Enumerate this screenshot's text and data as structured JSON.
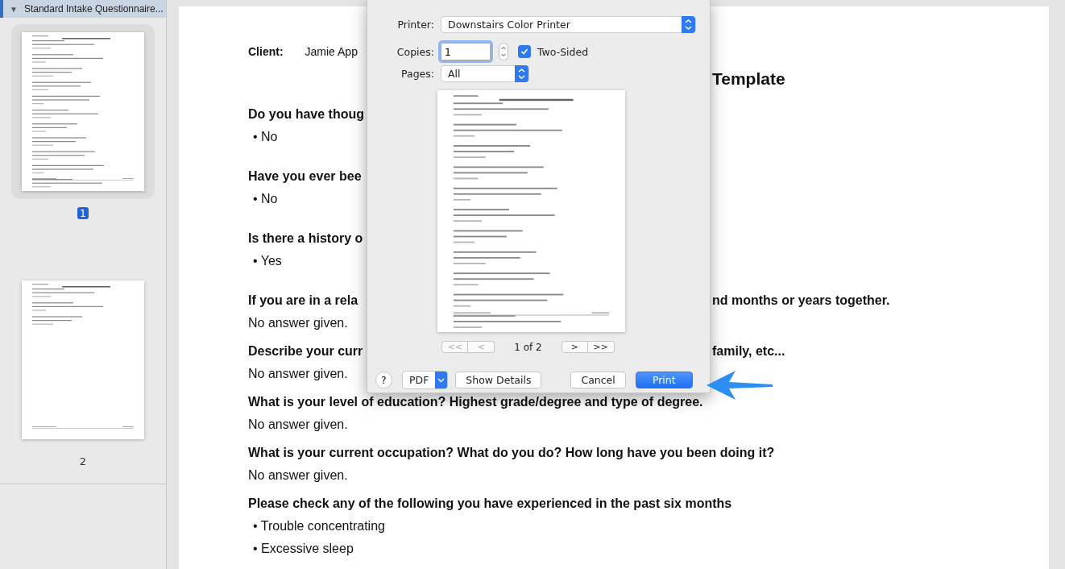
{
  "sidebar": {
    "toggle": "▼",
    "document_title": "Standard Intake Questionnaire...",
    "expanded": true,
    "pages": [
      {
        "number": "1",
        "selected": true
      },
      {
        "number": "2",
        "selected": false
      }
    ]
  },
  "document": {
    "client_label": "Client:",
    "client_name": "Jamie App",
    "title_tail": "Template",
    "blocks": [
      {
        "question": "Do you have thoug",
        "answers": [
          {
            "kind": "bullet",
            "marker": "•",
            "text": "No"
          }
        ]
      },
      {
        "question": "Have you ever bee",
        "answers": [
          {
            "kind": "bullet",
            "marker": "•",
            "text": "No"
          }
        ]
      },
      {
        "question": "Is there a history o",
        "answers": [
          {
            "kind": "bullet",
            "marker": "•",
            "text": "Yes"
          }
        ]
      },
      {
        "question": "If you are in a rela",
        "question_tail": "nd months or years together.",
        "answers": [
          {
            "kind": "plain",
            "text": "No answer given."
          }
        ]
      },
      {
        "question": "Describe your curr",
        "question_tail": "family, etc...",
        "answers": [
          {
            "kind": "plain",
            "text": "No answer given."
          }
        ]
      },
      {
        "question": "What is your level of education? Highest grade/degree and type of degree.",
        "answers": [
          {
            "kind": "plain",
            "text": "No answer given."
          }
        ]
      },
      {
        "question": "What is your current occupation? What do you do? How long have you been doing it?",
        "answers": [
          {
            "kind": "plain",
            "text": "No answer given."
          }
        ]
      },
      {
        "question": "Please check any of the following you have experienced in the past six months",
        "answers": [
          {
            "kind": "bullet",
            "marker": "•",
            "text": "Trouble concentrating"
          },
          {
            "kind": "bullet",
            "marker": "•",
            "text": "Excessive sleep"
          }
        ]
      }
    ]
  },
  "print_dialog": {
    "printer_label": "Printer:",
    "printer": "Downstairs Color Printer",
    "copies_label": "Copies:",
    "copies": "1",
    "two_sided": {
      "label": "Two-Sided",
      "checked": true
    },
    "pages_label": "Pages:",
    "pages": "All",
    "pager": {
      "buttons": [
        {
          "label": "<<",
          "disabled": true
        },
        {
          "label": "<",
          "disabled": true
        },
        {
          "label": ">",
          "disabled": false
        },
        {
          "label": ">>",
          "disabled": false
        }
      ],
      "position": "1 of 2"
    },
    "help": "?",
    "pdf": "PDF",
    "show_details": "Show Details",
    "cancel": "Cancel",
    "print": "Print"
  }
}
